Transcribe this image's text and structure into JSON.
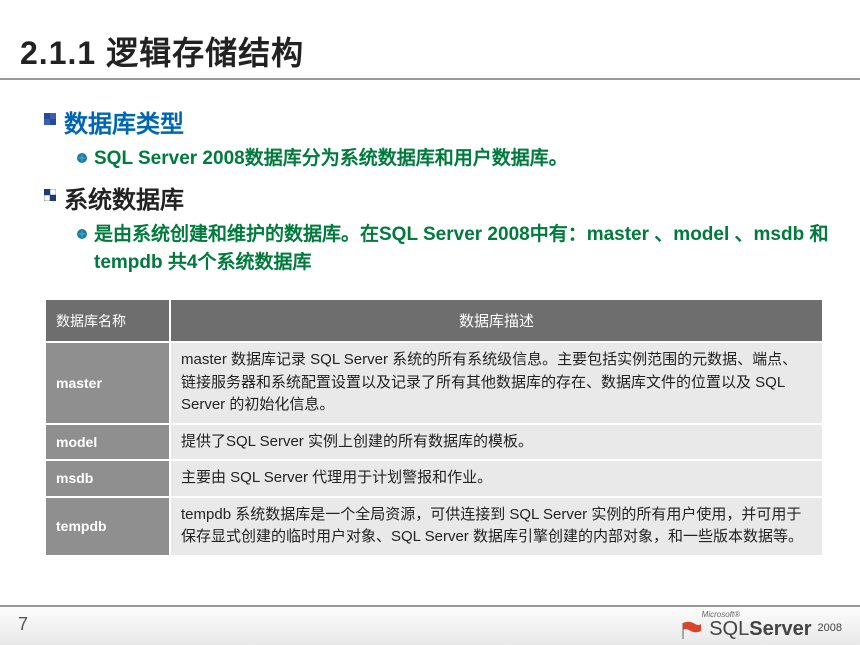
{
  "title": "2.1.1 逻辑存储结构",
  "sections": {
    "h1a": "数据库类型",
    "h1a_sub": "SQL Server 2008数据库分为系统数据库和用户数据库。",
    "h1b": "系统数据库",
    "h1b_sub": "是由系统创建和维护的数据库。在SQL Server 2008中有：master 、model 、msdb 和tempdb 共4个系统数据库"
  },
  "table": {
    "headers": {
      "name": "数据库名称",
      "desc": "数据库描述"
    },
    "rows": [
      {
        "name": "master",
        "desc": "master 数据库记录 SQL Server 系统的所有系统级信息。主要包括实例范围的元数据、端点、链接服务器和系统配置设置以及记录了所有其他数据库的存在、数据库文件的位置以及 SQL Server 的初始化信息。"
      },
      {
        "name": "model",
        "desc": "提供了SQL Server 实例上创建的所有数据库的模板。"
      },
      {
        "name": "msdb",
        "desc": "主要由 SQL Server 代理用于计划警报和作业。"
      },
      {
        "name": "tempdb",
        "desc": "tempdb 系统数据库是一个全局资源，可供连接到 SQL Server 实例的所有用户使用，并可用于保存显式创建的临时用户对象、SQL Server 数据库引擎创建的内部对象，和一些版本数据等。"
      }
    ]
  },
  "page_number": "7",
  "logo": {
    "ms": "Microsoft®",
    "sql": "SQL",
    "server": "Server",
    "year": "2008"
  }
}
